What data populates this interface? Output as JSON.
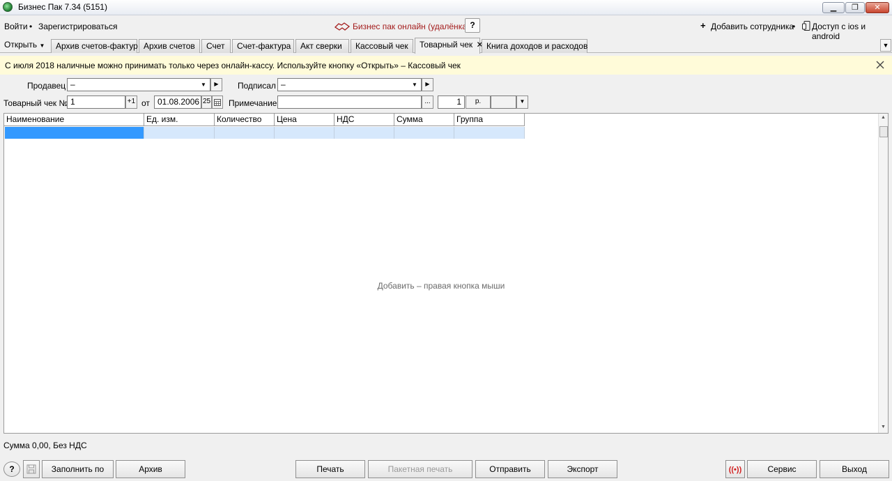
{
  "window": {
    "title": "Бизнес Пак 7.34 (5151)",
    "controls": {
      "minimize": "▁",
      "maximize": "❐",
      "close": "✕"
    }
  },
  "menu": {
    "login": "Войти",
    "separator": "•",
    "register": "Зарегистрироваться",
    "online": "Бизнес пак онлайн (удалёнка)",
    "help": "?",
    "add_employee": "Добавить сотрудника",
    "mobile_access": "Доступ с ios и android"
  },
  "tabs": {
    "open": "Открыть",
    "items": [
      {
        "label": "Архив счетов-фактур"
      },
      {
        "label": "Архив счетов"
      },
      {
        "label": "Счет"
      },
      {
        "label": "Счет-фактура"
      },
      {
        "label": "Акт сверки"
      },
      {
        "label": "Кассовый чек"
      },
      {
        "label": "Товарный чек",
        "active": true,
        "closable": true
      },
      {
        "label": "Книга доходов и расходов"
      }
    ],
    "close_glyph": "✕"
  },
  "banner": {
    "text": "С июля 2018 наличные можно принимать только через онлайн-кассу.  Используйте кнопку «Открыть» – Кассовый чек"
  },
  "form": {
    "seller_label": "Продавец",
    "seller_value": "–",
    "signed_label": "Подписал",
    "signed_value": "–",
    "receipt_label": "Товарный чек №",
    "receipt_number": "1",
    "increment": "+1",
    "from_label": "от",
    "date": "01.08.2006",
    "day_btn": "25",
    "note_label": "Примечание",
    "note_value": "",
    "ellipsis": "...",
    "quantity": "1",
    "currency": "р.",
    "extra_select": ""
  },
  "grid": {
    "columns": [
      "Наименование",
      "Ед. изм.",
      "Количество",
      "Цена",
      "НДС",
      "Сумма",
      "Группа"
    ],
    "hint": "Добавить – правая кнопка мыши"
  },
  "status": {
    "sum_line": "Сумма 0,00, Без НДС"
  },
  "toolbar": {
    "help": "?",
    "fill_by": "Заполнить по",
    "archive": "Архив",
    "print": "Печать",
    "batch_print": "Пакетная печать",
    "send": "Отправить",
    "export": "Экспорт",
    "service": "Сервис",
    "exit": "Выход"
  },
  "colors": {
    "online_link": "#a31c1c",
    "banner_bg": "#fffbd9",
    "row_highlight": "#d6e8fc",
    "selected_cell": "#3399ff",
    "signal_icon": "#d21f1f"
  }
}
